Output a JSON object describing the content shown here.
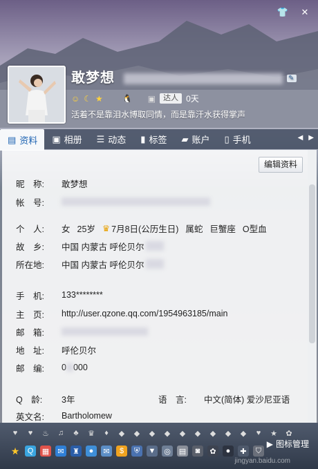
{
  "window": {
    "shirt_icon": "shirt-icon",
    "close_icon": "close-icon"
  },
  "profile": {
    "nickname_display": "敢梦想",
    "status_days": "0天",
    "daren_label": "达人",
    "signature": "活着不是靠泪水博取同情，而是靠汗水获得掌声"
  },
  "tabs": [
    {
      "label": "资料",
      "icon": "profile-card-icon",
      "active": true
    },
    {
      "label": "相册",
      "icon": "photo-icon",
      "active": false
    },
    {
      "label": "动态",
      "icon": "feed-icon",
      "active": false
    },
    {
      "label": "标签",
      "icon": "tag-icon",
      "active": false
    },
    {
      "label": "账户",
      "icon": "wallet-icon",
      "active": false
    },
    {
      "label": "手机",
      "icon": "phone-icon",
      "active": false
    }
  ],
  "edit_button": "编辑资料",
  "fields": {
    "nickname": {
      "label": "昵　称:",
      "value": "敢梦想"
    },
    "account": {
      "label": "帐　号:"
    },
    "personal": {
      "label": "个　人:",
      "gender": "女",
      "age": "25岁",
      "birthday": "7月8日(公历生日)",
      "zodiac": "属蛇",
      "star": "巨蟹座",
      "blood": "O型血"
    },
    "hometown": {
      "label": "故　乡:",
      "value": "中国 内蒙古 呼伦贝尔"
    },
    "location": {
      "label": "所在地:",
      "value": "中国 内蒙古 呼伦贝尔"
    },
    "mobile": {
      "label": "手　机:",
      "value": "133********"
    },
    "homepage": {
      "label": "主　页:",
      "value": "http://user.qzone.qq.com/1954963185/main"
    },
    "email": {
      "label": "邮　箱:"
    },
    "address": {
      "label": "地　址:",
      "value": "呼伦贝尔"
    },
    "postcode": {
      "label": "邮　编:",
      "value_prefix": "0",
      "value_suffix": "000"
    },
    "qage": {
      "label": "Q　龄:",
      "value": "3年"
    },
    "language": {
      "label": "语　言:",
      "value": "中文(简体) 爱沙尼亚语"
    },
    "english_name": {
      "label": "英文名:",
      "value": "Bartholomew"
    }
  },
  "bottom": {
    "manage_label": "图标管理",
    "watermark": "jingyan.baidu.com"
  }
}
